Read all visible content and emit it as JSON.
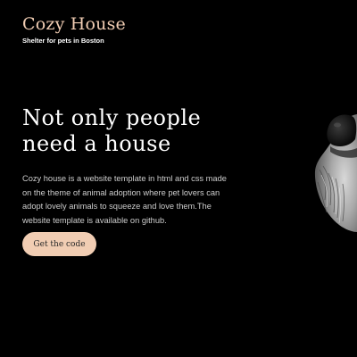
{
  "header": {
    "logo_title": "Cozy House",
    "logo_subtitle": "Shelter for pets in Boston"
  },
  "hero": {
    "title_line1": "Not only people",
    "title_line2": "need a house",
    "description": "Cozy house is a website template in html and css made on the theme of animal adoption where pet lovers can adopt lovely animals to squeeze and love them.The website template is available on github.",
    "button_label": "Get the code"
  },
  "colors": {
    "background": "#000000",
    "accent": "#f1cdb3",
    "text": "#ffffff"
  }
}
